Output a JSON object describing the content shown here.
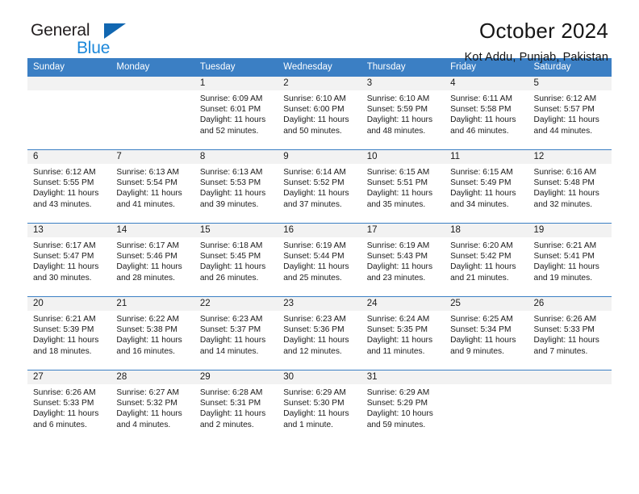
{
  "brand": {
    "name_top": "General",
    "name_bottom": "Blue",
    "color_top": "#231f20",
    "color_bottom": "#1b87da",
    "triangle_color": "#1167b1"
  },
  "header": {
    "title": "October 2024",
    "subtitle": "Kot Addu, Punjab, Pakistan"
  },
  "colors": {
    "header_blue": "#3b7fc4",
    "daynum_band": "#f2f2f2",
    "text": "#1a1a1a"
  },
  "calendar": {
    "weekday_headers": [
      "Sunday",
      "Monday",
      "Tuesday",
      "Wednesday",
      "Thursday",
      "Friday",
      "Saturday"
    ],
    "weeks": [
      [
        {
          "day": "",
          "lines": []
        },
        {
          "day": "",
          "lines": []
        },
        {
          "day": "1",
          "lines": [
            "Sunrise: 6:09 AM",
            "Sunset: 6:01 PM",
            "Daylight: 11 hours",
            "and 52 minutes."
          ]
        },
        {
          "day": "2",
          "lines": [
            "Sunrise: 6:10 AM",
            "Sunset: 6:00 PM",
            "Daylight: 11 hours",
            "and 50 minutes."
          ]
        },
        {
          "day": "3",
          "lines": [
            "Sunrise: 6:10 AM",
            "Sunset: 5:59 PM",
            "Daylight: 11 hours",
            "and 48 minutes."
          ]
        },
        {
          "day": "4",
          "lines": [
            "Sunrise: 6:11 AM",
            "Sunset: 5:58 PM",
            "Daylight: 11 hours",
            "and 46 minutes."
          ]
        },
        {
          "day": "5",
          "lines": [
            "Sunrise: 6:12 AM",
            "Sunset: 5:57 PM",
            "Daylight: 11 hours",
            "and 44 minutes."
          ]
        }
      ],
      [
        {
          "day": "6",
          "lines": [
            "Sunrise: 6:12 AM",
            "Sunset: 5:55 PM",
            "Daylight: 11 hours",
            "and 43 minutes."
          ]
        },
        {
          "day": "7",
          "lines": [
            "Sunrise: 6:13 AM",
            "Sunset: 5:54 PM",
            "Daylight: 11 hours",
            "and 41 minutes."
          ]
        },
        {
          "day": "8",
          "lines": [
            "Sunrise: 6:13 AM",
            "Sunset: 5:53 PM",
            "Daylight: 11 hours",
            "and 39 minutes."
          ]
        },
        {
          "day": "9",
          "lines": [
            "Sunrise: 6:14 AM",
            "Sunset: 5:52 PM",
            "Daylight: 11 hours",
            "and 37 minutes."
          ]
        },
        {
          "day": "10",
          "lines": [
            "Sunrise: 6:15 AM",
            "Sunset: 5:51 PM",
            "Daylight: 11 hours",
            "and 35 minutes."
          ]
        },
        {
          "day": "11",
          "lines": [
            "Sunrise: 6:15 AM",
            "Sunset: 5:49 PM",
            "Daylight: 11 hours",
            "and 34 minutes."
          ]
        },
        {
          "day": "12",
          "lines": [
            "Sunrise: 6:16 AM",
            "Sunset: 5:48 PM",
            "Daylight: 11 hours",
            "and 32 minutes."
          ]
        }
      ],
      [
        {
          "day": "13",
          "lines": [
            "Sunrise: 6:17 AM",
            "Sunset: 5:47 PM",
            "Daylight: 11 hours",
            "and 30 minutes."
          ]
        },
        {
          "day": "14",
          "lines": [
            "Sunrise: 6:17 AM",
            "Sunset: 5:46 PM",
            "Daylight: 11 hours",
            "and 28 minutes."
          ]
        },
        {
          "day": "15",
          "lines": [
            "Sunrise: 6:18 AM",
            "Sunset: 5:45 PM",
            "Daylight: 11 hours",
            "and 26 minutes."
          ]
        },
        {
          "day": "16",
          "lines": [
            "Sunrise: 6:19 AM",
            "Sunset: 5:44 PM",
            "Daylight: 11 hours",
            "and 25 minutes."
          ]
        },
        {
          "day": "17",
          "lines": [
            "Sunrise: 6:19 AM",
            "Sunset: 5:43 PM",
            "Daylight: 11 hours",
            "and 23 minutes."
          ]
        },
        {
          "day": "18",
          "lines": [
            "Sunrise: 6:20 AM",
            "Sunset: 5:42 PM",
            "Daylight: 11 hours",
            "and 21 minutes."
          ]
        },
        {
          "day": "19",
          "lines": [
            "Sunrise: 6:21 AM",
            "Sunset: 5:41 PM",
            "Daylight: 11 hours",
            "and 19 minutes."
          ]
        }
      ],
      [
        {
          "day": "20",
          "lines": [
            "Sunrise: 6:21 AM",
            "Sunset: 5:39 PM",
            "Daylight: 11 hours",
            "and 18 minutes."
          ]
        },
        {
          "day": "21",
          "lines": [
            "Sunrise: 6:22 AM",
            "Sunset: 5:38 PM",
            "Daylight: 11 hours",
            "and 16 minutes."
          ]
        },
        {
          "day": "22",
          "lines": [
            "Sunrise: 6:23 AM",
            "Sunset: 5:37 PM",
            "Daylight: 11 hours",
            "and 14 minutes."
          ]
        },
        {
          "day": "23",
          "lines": [
            "Sunrise: 6:23 AM",
            "Sunset: 5:36 PM",
            "Daylight: 11 hours",
            "and 12 minutes."
          ]
        },
        {
          "day": "24",
          "lines": [
            "Sunrise: 6:24 AM",
            "Sunset: 5:35 PM",
            "Daylight: 11 hours",
            "and 11 minutes."
          ]
        },
        {
          "day": "25",
          "lines": [
            "Sunrise: 6:25 AM",
            "Sunset: 5:34 PM",
            "Daylight: 11 hours",
            "and 9 minutes."
          ]
        },
        {
          "day": "26",
          "lines": [
            "Sunrise: 6:26 AM",
            "Sunset: 5:33 PM",
            "Daylight: 11 hours",
            "and 7 minutes."
          ]
        }
      ],
      [
        {
          "day": "27",
          "lines": [
            "Sunrise: 6:26 AM",
            "Sunset: 5:33 PM",
            "Daylight: 11 hours",
            "and 6 minutes."
          ]
        },
        {
          "day": "28",
          "lines": [
            "Sunrise: 6:27 AM",
            "Sunset: 5:32 PM",
            "Daylight: 11 hours",
            "and 4 minutes."
          ]
        },
        {
          "day": "29",
          "lines": [
            "Sunrise: 6:28 AM",
            "Sunset: 5:31 PM",
            "Daylight: 11 hours",
            "and 2 minutes."
          ]
        },
        {
          "day": "30",
          "lines": [
            "Sunrise: 6:29 AM",
            "Sunset: 5:30 PM",
            "Daylight: 11 hours",
            "and 1 minute."
          ]
        },
        {
          "day": "31",
          "lines": [
            "Sunrise: 6:29 AM",
            "Sunset: 5:29 PM",
            "Daylight: 10 hours",
            "and 59 minutes."
          ]
        },
        {
          "day": "",
          "lines": []
        },
        {
          "day": "",
          "lines": []
        }
      ]
    ]
  }
}
